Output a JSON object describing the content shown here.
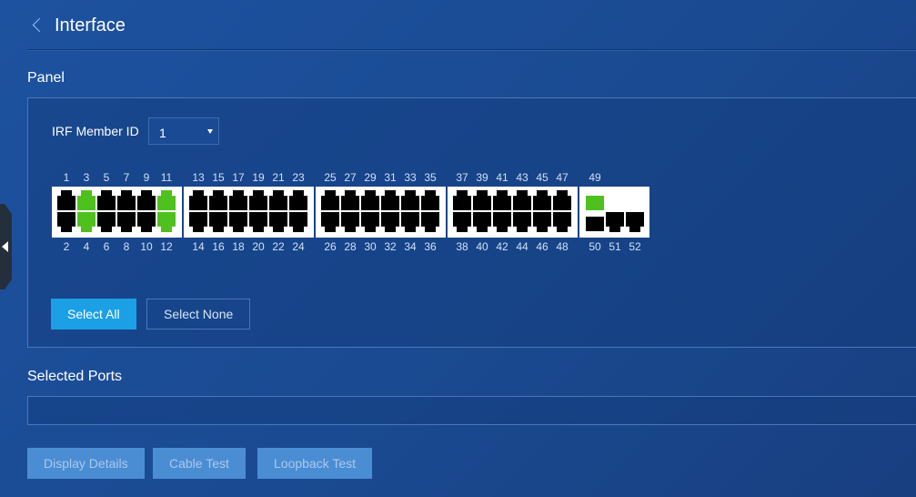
{
  "header": {
    "title": "Interface"
  },
  "panel": {
    "label": "Panel",
    "irf_label": "IRF Member ID",
    "irf_value": "1",
    "top_numbers": [
      [
        "1",
        "3",
        "5",
        "7",
        "9",
        "11"
      ],
      [
        "13",
        "15",
        "17",
        "19",
        "21",
        "23"
      ],
      [
        "25",
        "27",
        "29",
        "31",
        "33",
        "35"
      ],
      [
        "37",
        "39",
        "41",
        "43",
        "45",
        "47"
      ],
      [
        "49"
      ]
    ],
    "bottom_numbers": [
      [
        "2",
        "4",
        "6",
        "8",
        "10",
        "12"
      ],
      [
        "14",
        "16",
        "18",
        "20",
        "22",
        "24"
      ],
      [
        "26",
        "28",
        "30",
        "32",
        "34",
        "36"
      ],
      [
        "38",
        "40",
        "42",
        "44",
        "46",
        "48"
      ],
      [
        "50",
        "51",
        "52"
      ]
    ],
    "ports_up": [
      "3",
      "4",
      "11",
      "12",
      "49"
    ],
    "select_all": "Select All",
    "select_none": "Select None"
  },
  "selected": {
    "label": "Selected Ports",
    "value": ""
  },
  "actions": {
    "display_details": "Display Details",
    "cable_test": "Cable Test",
    "loopback_test": "Loopback Test"
  },
  "colors": {
    "port_up": "#4fc11f",
    "port_down": "#000000",
    "primary": "#1ba0e6"
  }
}
